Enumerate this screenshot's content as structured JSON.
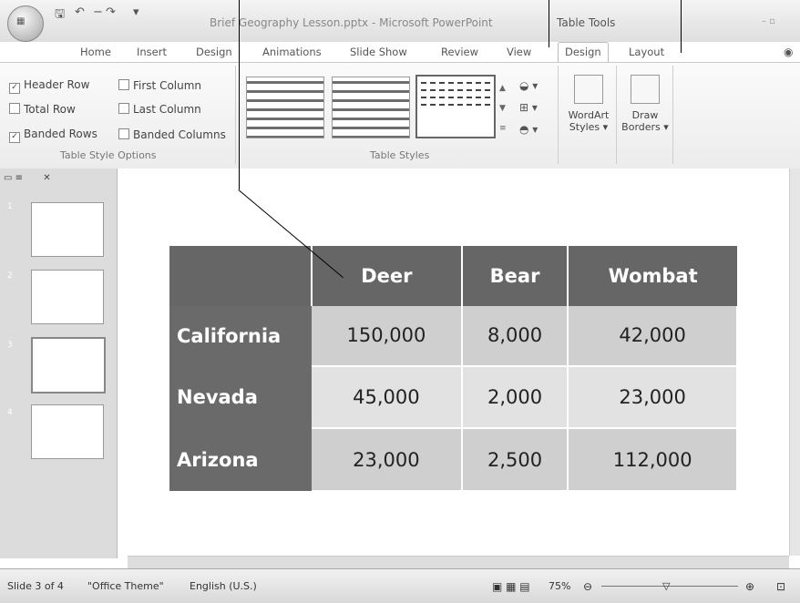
{
  "titlebar": {
    "office_button": "Office",
    "doc_title": "Brief Geography Lesson.pptx - Microsoft PowerPoint",
    "context_tab_title": "Table Tools"
  },
  "tabs": [
    "Home",
    "Insert",
    "Design",
    "Animations",
    "Slide Show",
    "Review",
    "View",
    "Design",
    "Layout"
  ],
  "ribbon": {
    "table_style_options": {
      "options": [
        {
          "label": "Header Row",
          "checked": true
        },
        {
          "label": "First Column",
          "checked": false
        },
        {
          "label": "Total Row",
          "checked": false
        },
        {
          "label": "Last Column",
          "checked": false
        },
        {
          "label": "Banded Rows",
          "checked": true
        },
        {
          "label": "Banded Columns",
          "checked": false
        }
      ],
      "group_label": "Table Style Options"
    },
    "table_styles": {
      "group_label": "Table Styles"
    },
    "wordart": {
      "label_line1": "WordArt",
      "label_line2": "Styles ▾"
    },
    "draw_borders": {
      "label_line1": "Draw",
      "label_line2": "Borders ▾"
    }
  },
  "slide_panel": {
    "numbers": [
      "1",
      "2",
      "3",
      "4"
    ],
    "selected": "3"
  },
  "table": {
    "headers": [
      "",
      "Deer",
      "Bear",
      "Wombat"
    ],
    "rows": [
      {
        "label": "California",
        "values": [
          "150,000",
          "8,000",
          "42,000"
        ]
      },
      {
        "label": "Nevada",
        "values": [
          "45,000",
          "2,000",
          "23,000"
        ]
      },
      {
        "label": "Arizona",
        "values": [
          "23,000",
          "2,500",
          "112,000"
        ]
      }
    ]
  },
  "statusbar": {
    "slide": "Slide 3 of 4",
    "theme": "\"Office Theme\"",
    "language": "English (U.S.)",
    "zoom": "75%"
  }
}
